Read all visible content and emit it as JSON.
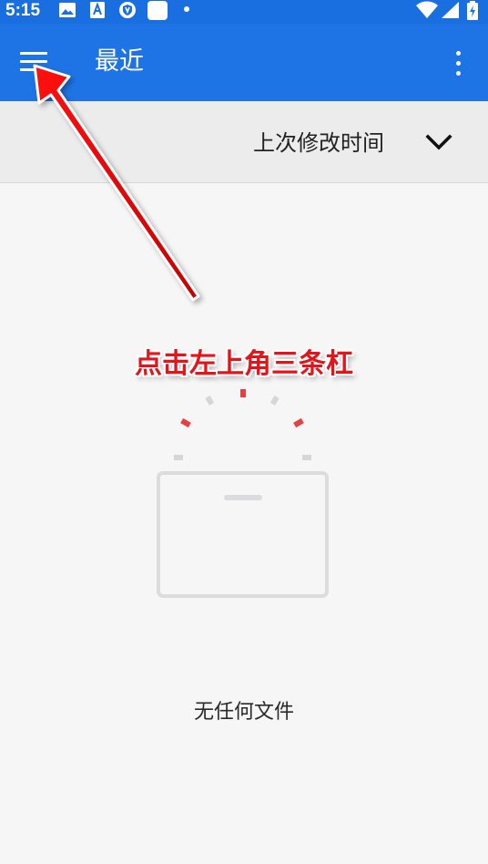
{
  "status_bar": {
    "time": "5:15",
    "icons": [
      "image-icon",
      "font-app-icon",
      "shield-icon",
      "square-app-icon",
      "dot-icon",
      "wifi-icon",
      "signal-icon",
      "battery-charging-icon"
    ]
  },
  "app_bar": {
    "title": "最近",
    "menu_icon": "hamburger-menu-icon",
    "overflow_icon": "more-vert-icon"
  },
  "sort_bar": {
    "label": "上次修改时间",
    "chevron_icon": "chevron-down-icon"
  },
  "empty_state": {
    "message": "无任何文件",
    "illustration": "empty-box-icon"
  },
  "annotation": {
    "text": "点击左上角三条杠",
    "color": "#e4141b"
  },
  "colors": {
    "primary": "#1f74e5",
    "status_bar": "#1a6fe0",
    "background": "#f6f6f6"
  }
}
